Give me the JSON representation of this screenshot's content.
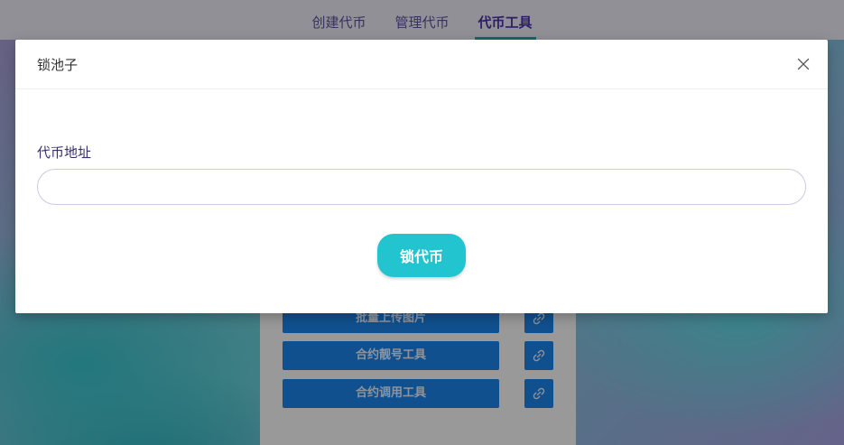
{
  "nav": {
    "tabs": [
      {
        "label": "创建代币"
      },
      {
        "label": "管理代币"
      },
      {
        "label": "代币工具"
      }
    ]
  },
  "tools": [
    {
      "label": "批量上传图片",
      "icon": "link-icon"
    },
    {
      "label": "合约靓号工具",
      "icon": "link-icon"
    },
    {
      "label": "合约调用工具",
      "icon": "link-icon"
    }
  ],
  "modal": {
    "title": "锁池子",
    "close_icon": "close-icon",
    "field_label": "代币地址",
    "field_value": "",
    "field_placeholder": "",
    "submit_label": "锁代币"
  },
  "colors": {
    "accent": "#22c4d0",
    "tab_active": "#4a2fa8",
    "tool_button": "#1a82e6"
  }
}
